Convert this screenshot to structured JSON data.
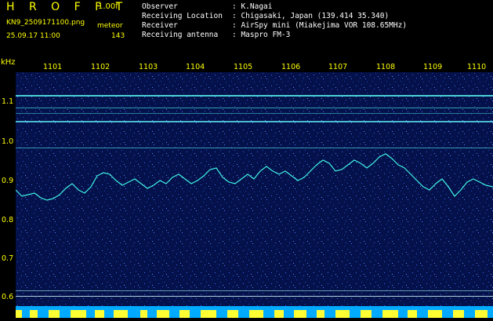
{
  "header": {
    "title": "H R O F F T",
    "version": "1.00f",
    "filename": "KN9_2509171100.png",
    "mode": "meteor",
    "datetime": "25.09.17 11:00",
    "count": "143",
    "observer_label": "Observer",
    "observer_value": ": K.Nagai",
    "location_label": "Receiving Location",
    "location_value": ": Chigasaki, Japan (139.414 35.340)",
    "receiver_label": "Receiver",
    "receiver_value": ": AirSpy mini (Miakejima VOR 108.65MHz)",
    "antenna_label": "Receiving antenna",
    "antenna_value": ": Maspro FM-3"
  },
  "axis": {
    "unit": "kHz",
    "time_ticks": [
      "1101",
      "1102",
      "1103",
      "1104",
      "1105",
      "1106",
      "1107",
      "1108",
      "1109",
      "1110"
    ],
    "freq_ticks": [
      "1.1",
      "1.0",
      "0.9",
      "0.8",
      "0.7",
      "0.6"
    ]
  },
  "colors": {
    "label": "#ffff00",
    "background": "#04114a",
    "trace": "#44ffee"
  }
}
